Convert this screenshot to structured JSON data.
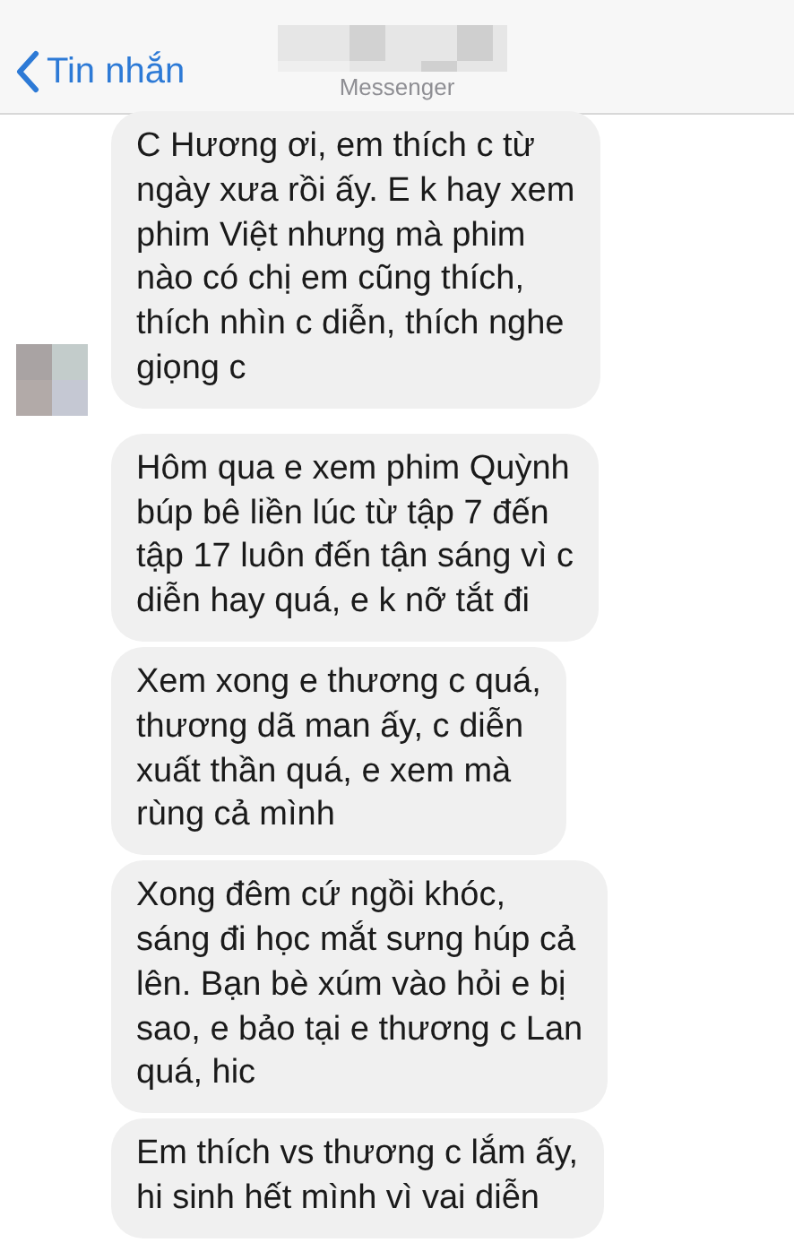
{
  "header": {
    "back_label": "Tin nhắn",
    "subtitle": "Messenger"
  },
  "messages": [
    {
      "text": "C Hương ơi, em thích c từ\nngày xưa rồi ấy. E k hay xem\nphim Việt nhưng mà phim\nnào có chị em cũng thích,\nthích nhìn c diễn, thích nghe\ngiọng c",
      "avatar": true
    },
    {
      "text": "Hôm qua e xem phim Quỳnh\nbúp bê liền lúc từ tập 7 đến\ntập 17 luôn đến tận sáng vì c\ndiễn hay quá, e k nỡ tắt đi",
      "avatar": false
    },
    {
      "text": "Xem xong e thương c quá,\nthương dã man ấy, c diễn\nxuất thần quá, e xem mà\nrùng cả mình",
      "avatar": false
    },
    {
      "text": "Xong đêm cứ ngồi khóc,\nsáng đi học mắt sưng húp cả\nlên. Bạn bè xúm vào hỏi e bị\nsao, e bảo tại e thương c Lan\nquá, hic",
      "avatar": false
    },
    {
      "text": "Em thích vs thương c lắm ấy,\nhi sinh hết mình vì vai diễn",
      "avatar": false
    }
  ]
}
